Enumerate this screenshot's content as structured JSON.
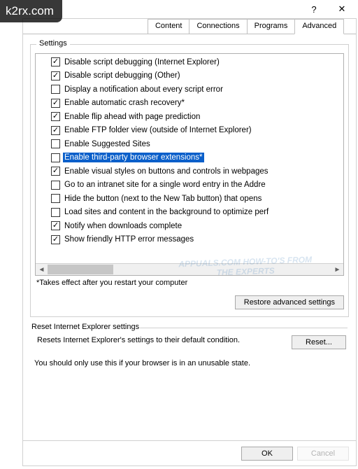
{
  "watermark_site": "k2rx.com",
  "titlebar": {
    "help": "?",
    "close": "✕"
  },
  "tabs": {
    "partial_1": "Content",
    "partial_2": "Connections",
    "partial_3": "Programs",
    "active": "Advanced"
  },
  "settings": {
    "legend": "Settings",
    "items": [
      {
        "checked": true,
        "label": "Disable script debugging (Internet Explorer)",
        "selected": false
      },
      {
        "checked": true,
        "label": "Disable script debugging (Other)",
        "selected": false
      },
      {
        "checked": false,
        "label": "Display a notification about every script error",
        "selected": false
      },
      {
        "checked": true,
        "label": "Enable automatic crash recovery*",
        "selected": false
      },
      {
        "checked": true,
        "label": "Enable flip ahead with page prediction",
        "selected": false
      },
      {
        "checked": true,
        "label": "Enable FTP folder view (outside of Internet Explorer)",
        "selected": false
      },
      {
        "checked": false,
        "label": "Enable Suggested Sites",
        "selected": false
      },
      {
        "checked": false,
        "label": "Enable third-party browser extensions*",
        "selected": true
      },
      {
        "checked": true,
        "label": "Enable visual styles on buttons and controls in webpages",
        "selected": false
      },
      {
        "checked": false,
        "label": "Go to an intranet site for a single word entry in the Addre",
        "selected": false
      },
      {
        "checked": false,
        "label": "Hide the button (next to the New Tab button) that opens",
        "selected": false
      },
      {
        "checked": false,
        "label": "Load sites and content in the background to optimize perf",
        "selected": false
      },
      {
        "checked": true,
        "label": "Notify when downloads complete",
        "selected": false
      },
      {
        "checked": true,
        "label": "Show friendly HTTP error messages",
        "selected": false
      }
    ],
    "footnote": "*Takes effect after you restart your computer",
    "restore_btn": "Restore advanced settings"
  },
  "reset": {
    "legend": "Reset Internet Explorer settings",
    "desc": "Resets Internet Explorer's settings to their default condition.",
    "btn": "Reset...",
    "note": "You should only use this if your browser is in an unusable state."
  },
  "footer": {
    "ok": "OK",
    "cancel": "Cancel"
  },
  "bg_watermark": "APPUALS.COM\nHOW-TO'S FROM\nTHE EXPERTS"
}
